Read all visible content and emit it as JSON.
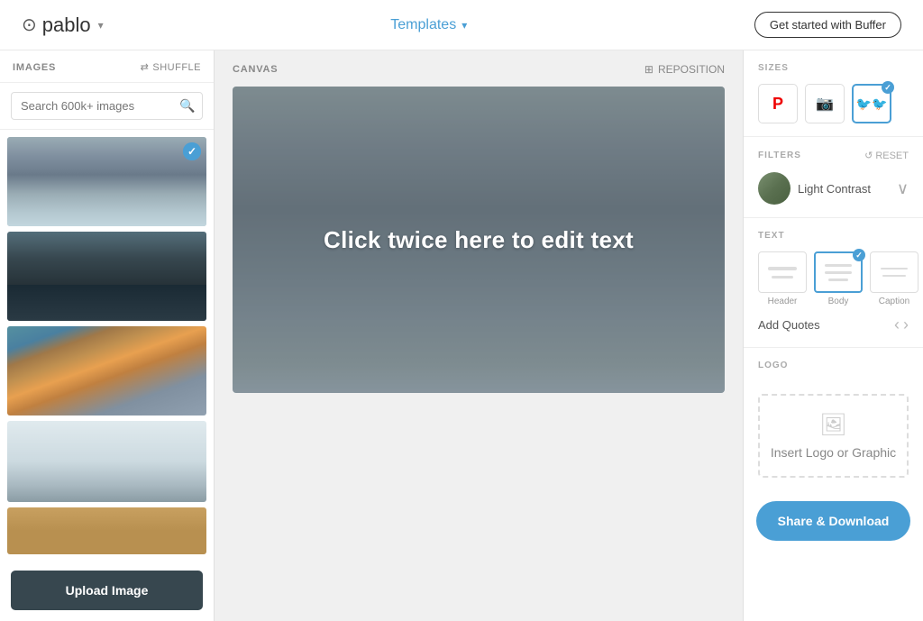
{
  "header": {
    "logo_icon": "⊙",
    "logo_text": "pablo",
    "logo_caret": "∨",
    "templates_label": "Templates",
    "templates_caret": "∨",
    "buffer_btn": "Get started with Buffer"
  },
  "left_panel": {
    "images_label": "IMAGES",
    "shuffle_label": "SHUFFLE",
    "search_placeholder": "Search 600k+ images",
    "upload_label": "Upload Image"
  },
  "center_panel": {
    "canvas_label": "CANVAS",
    "reposition_label": "REPOSITION",
    "canvas_text": "Click twice here to edit text"
  },
  "right_panel": {
    "sizes_label": "SIZES",
    "filters_label": "FILTERS",
    "reset_label": "RESET",
    "filter_name": "Light Contrast",
    "text_label": "TEXT",
    "header_label": "Header",
    "body_label": "Body",
    "caption_label": "Caption",
    "add_quotes_label": "Add Quotes",
    "logo_label": "LOGO",
    "logo_insert_label": "Insert Logo or Graphic",
    "share_label": "Share & Download"
  }
}
